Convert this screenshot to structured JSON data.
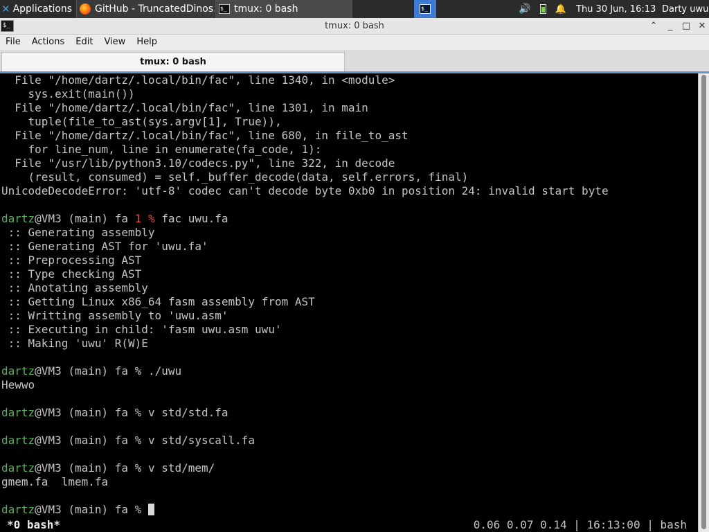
{
  "panel": {
    "apps_label": "Applications",
    "github_task": "GitHub - TruncatedDinos...",
    "tmux_task": "tmux: 0 bash",
    "clock": "Thu 30 Jun, 16:13",
    "user": "Darty uwu",
    "icons": {
      "apps": "xfce-logo-icon",
      "volume": "volume-icon",
      "battery": "battery-icon",
      "notify": "bell-icon"
    }
  },
  "window": {
    "title": "tmux: 0 bash",
    "buttons": {
      "up": "⌃",
      "minimize": "_",
      "maximize": "□",
      "close": "✕"
    }
  },
  "menubar": {
    "file": "File",
    "actions": "Actions",
    "edit": "Edit",
    "view": "View",
    "help": "Help"
  },
  "tab": {
    "label": "tmux: 0 bash"
  },
  "terminal": {
    "lines": [
      "  File \"/home/dartz/.local/bin/fac\", line 1340, in <module>",
      "    sys.exit(main())",
      "  File \"/home/dartz/.local/bin/fac\", line 1301, in main",
      "    tuple(file_to_ast(sys.argv[1], True)),",
      "  File \"/home/dartz/.local/bin/fac\", line 680, in file_to_ast",
      "    for line_num, line in enumerate(fa_code, 1):",
      "  File \"/usr/lib/python3.10/codecs.py\", line 322, in decode",
      "    (result, consumed) = self._buffer_decode(data, self.errors, final)",
      "UnicodeDecodeError: 'utf-8' codec can't decode byte 0xb0 in position 24: invalid start byte",
      "",
      "",
      " :: Generating assembly",
      " :: Generating AST for 'uwu.fa'",
      " :: Preprocessing AST",
      " :: Type checking AST",
      " :: Anotating assembly",
      " :: Getting Linux x86_64 fasm assembly from AST",
      " :: Writting assembly to 'uwu.asm'",
      " :: Executing in child: 'fasm uwu.asm uwu'",
      " :: Making 'uwu' R(W)E",
      "",
      "",
      "Hewwo",
      "",
      "",
      "",
      "",
      "",
      "",
      "gmem.fa  lmem.fa",
      "",
      ""
    ],
    "prompt_user": "dartz",
    "prompt_host": "@VM3 (main) fa ",
    "err_status": "1 %",
    "cmd1": " fac uwu.fa",
    "cmd2": "% ./uwu",
    "cmd3": "% v std/std.fa",
    "cmd4": "% v std/syscall.fa",
    "cmd5": "% v std/mem/",
    "cmd6": "% ",
    "status_left": "*0 bash*",
    "status_right": "0.06 0.07 0.14 | 16:13:00 | bash"
  }
}
